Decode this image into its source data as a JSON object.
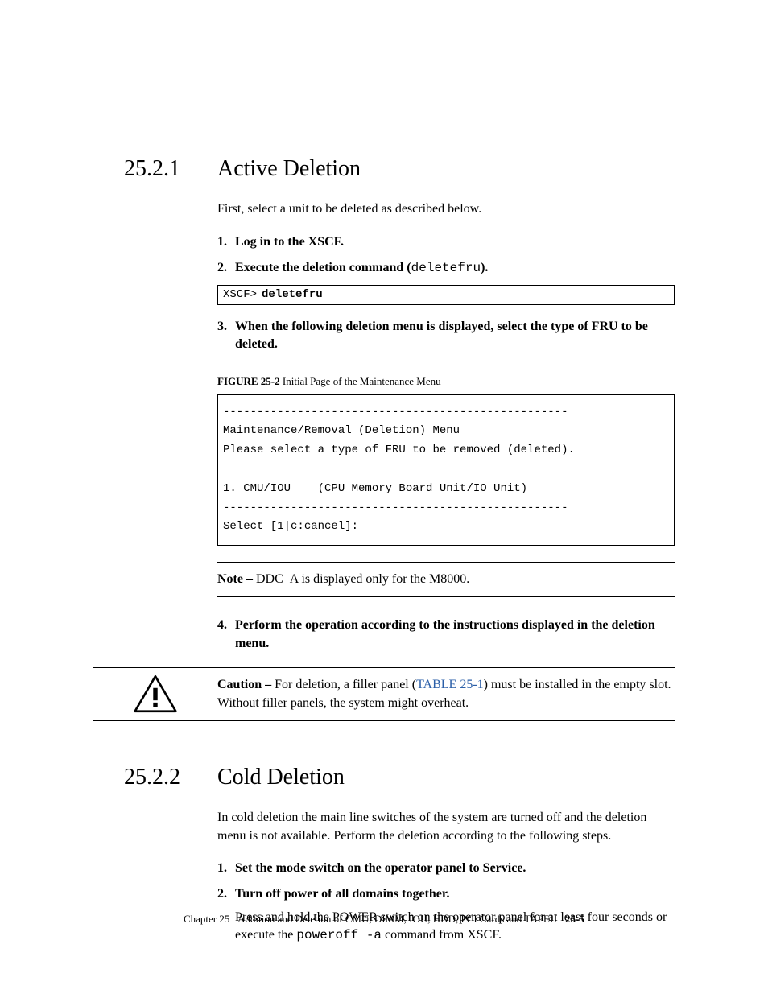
{
  "sections": {
    "s1": {
      "num": "25.2.1",
      "title": "Active Deletion"
    },
    "s2": {
      "num": "25.2.2",
      "title": "Cold Deletion"
    }
  },
  "s1": {
    "intro": "First, select a unit to be deleted as described below.",
    "step1_num": "1.",
    "step1": "Log in to the XSCF.",
    "step2_num": "2.",
    "step2_a": "Execute the deletion command (",
    "step2_cmd": "deletefru",
    "step2_b": ").",
    "code1_prompt": "XSCF>",
    "code1_cmd": "deletefru",
    "step3_num": "3.",
    "step3": "When the following deletion menu is displayed, select the type of FRU to be deleted.",
    "fig_label": "FIGURE 25-2",
    "fig_title": "Initial Page of the Maintenance Menu",
    "code2": "---------------------------------------------------\nMaintenance/Removal (Deletion) Menu\nPlease select a type of FRU to be removed (deleted).\n\n1. CMU/IOU    (CPU Memory Board Unit/IO Unit)\n---------------------------------------------------\nSelect [1|c:cancel]:",
    "note_label": "Note –",
    "note_body": " DDC_A is displayed only for the M8000.",
    "step4_num": "4.",
    "step4": "Perform the operation according to the instructions displayed in the deletion menu.",
    "caution_label": "Caution –",
    "caution_a": " For deletion, a filler panel (",
    "caution_xref": "TABLE 25-1",
    "caution_b": ") must be installed in the empty slot. Without filler panels, the system might overheat."
  },
  "s2": {
    "intro": "In cold deletion the main line switches of the system are turned off and the deletion menu is not available. Perform the deletion according to the following steps.",
    "step1_num": "1.",
    "step1": "Set the mode switch on the operator panel to Service.",
    "step2_num": "2.",
    "step2": "Turn off power of all domains together.",
    "step2_note_a": "Press and hold the POWER switch on the operator panel for at least four seconds or execute the ",
    "step2_cmd": "poweroff -a",
    "step2_note_b": " command from XSCF."
  },
  "footer": {
    "chapter": "Chapter 25",
    "title": "Addition and Deletion of CMU, DIMM, IOU, HDD, PCI Cards and TAPEU",
    "page": "25-5"
  }
}
